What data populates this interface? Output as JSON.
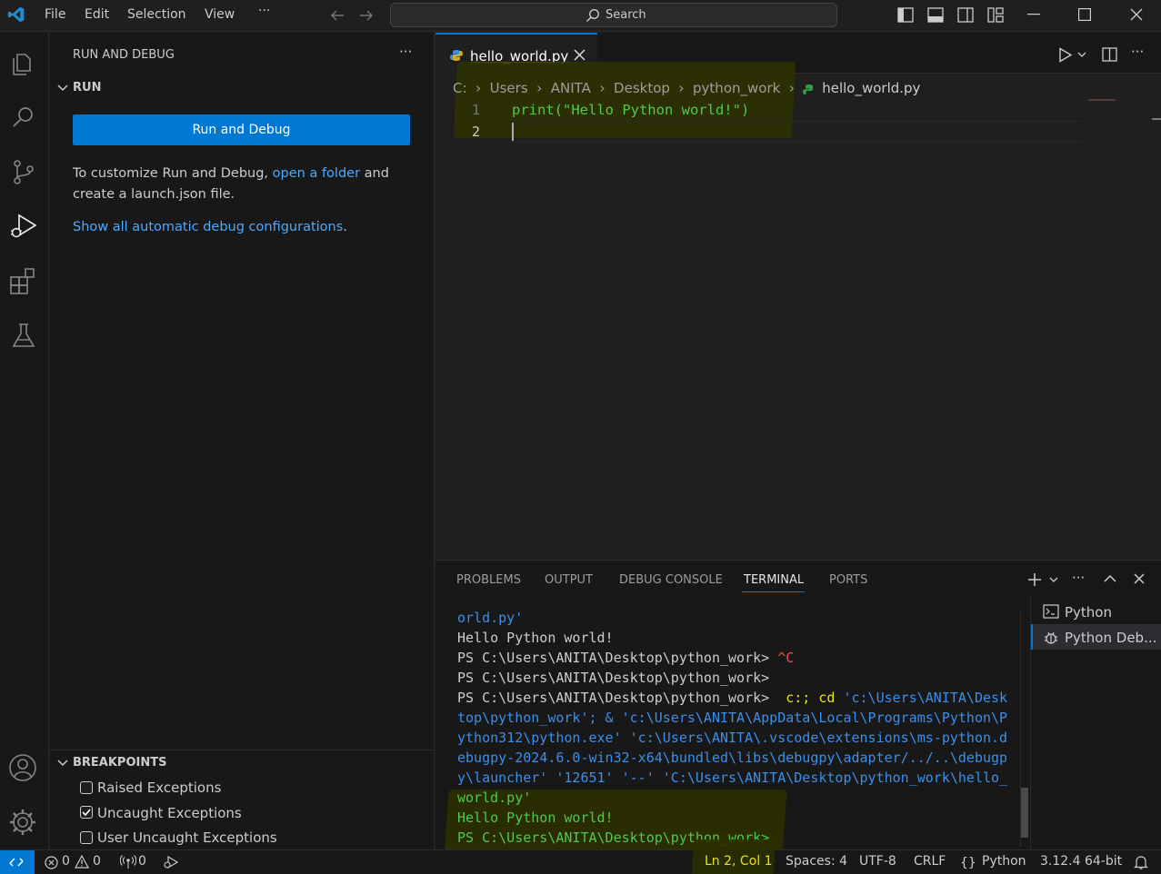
{
  "titlebar": {
    "menu": [
      "File",
      "Edit",
      "Selection",
      "View",
      "···"
    ],
    "search_placeholder": "Search"
  },
  "sidebar": {
    "header": "RUN AND DEBUG",
    "more": "···",
    "section_run": "RUN",
    "run_button": "Run and Debug",
    "help_prefix": "To customize Run and Debug,",
    "help_link": "open a folder",
    "help_suffix": "and",
    "help_line2": "create a launch.json file.",
    "show_configs_link": "Show all automatic debug configurations",
    "show_configs_period": ".",
    "section_breakpoints": "BREAKPOINTS",
    "breakpoints": [
      {
        "label": "Raised Exceptions",
        "checked": false
      },
      {
        "label": "Uncaught Exceptions",
        "checked": true
      },
      {
        "label": "User Uncaught Exceptions",
        "checked": false
      }
    ]
  },
  "editor": {
    "tab_label": "hello_world.py",
    "breadcrumb": [
      "C:",
      "Users",
      "ANITA",
      "Desktop",
      "python_work",
      "hello_world.py"
    ],
    "lines": [
      {
        "num": "1",
        "text": "print(\"Hello Python world!\")"
      },
      {
        "num": "2",
        "text": ""
      }
    ]
  },
  "panel": {
    "tabs": [
      "PROBLEMS",
      "OUTPUT",
      "DEBUG CONSOLE",
      "TERMINAL",
      "PORTS"
    ],
    "active_tab": "TERMINAL",
    "terminals": [
      "Python",
      "Python Deb..."
    ],
    "lines": [
      {
        "text": "orld.py'",
        "color": "#3b8eea"
      },
      {
        "text": "Hello Python world!",
        "color": "#cccccc"
      },
      {
        "text": "PS C:\\Users\\ANITA\\Desktop\\python_work> ",
        "extra": "^C",
        "extra_color": "#f14c4c",
        "color": "#cccccc"
      },
      {
        "text": "PS C:\\Users\\ANITA\\Desktop\\python_work>",
        "color": "#cccccc"
      },
      {
        "text": "PS C:\\Users\\ANITA\\Desktop\\python_work>  ",
        "extra": "c:; cd ",
        "extra_color": "#e5e510",
        "tail": "'c:\\Users\\ANITA\\Desk",
        "tail_color": "#3b8eea",
        "color": "#cccccc"
      },
      {
        "text": "top\\python_work'; & 'c:\\Users\\ANITA\\AppData\\Local\\Programs\\Python\\P",
        "color": "#3b8eea"
      },
      {
        "text": "ython312\\python.exe' 'c:\\Users\\ANITA\\.vscode\\extensions\\ms-python.d",
        "color": "#3b8eea"
      },
      {
        "text": "ebugpy-2024.6.0-win32-x64\\bundled\\libs\\debugpy\\adapter/../..\\debugp",
        "color": "#3b8eea"
      },
      {
        "text": "y\\launcher' '12651' '--' 'C:\\Users\\ANITA\\Desktop\\python_work\\hello_",
        "color": "#3b8eea"
      },
      {
        "text": "world.py'",
        "color": "#3b8eea"
      },
      {
        "text": "Hello Python world!",
        "color": "#cccccc"
      },
      {
        "text": "PS C:\\Users\\ANITA\\Desktop\\python_work>",
        "color": "#cccccc"
      }
    ]
  },
  "statusbar": {
    "errors": "0",
    "warnings": "0",
    "ports": "0",
    "position": "Ln 2, Col 1",
    "spaces": "Spaces: 4",
    "encoding": "UTF-8",
    "eol": "CRLF",
    "language": "Python",
    "interpreter": "3.12.4 64-bit"
  },
  "colors": {
    "accent": "#0078d4",
    "link": "#4daafc",
    "highlight": "#3d3d00"
  }
}
